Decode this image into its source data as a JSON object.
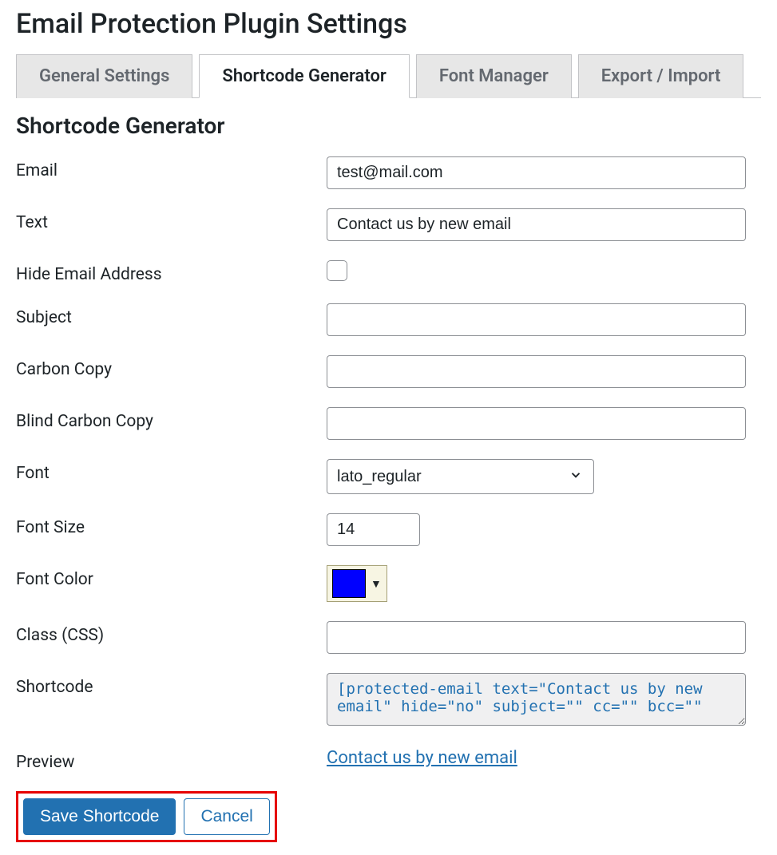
{
  "page_title": "Email Protection Plugin Settings",
  "tabs": {
    "general": "General Settings",
    "shortcode": "Shortcode Generator",
    "font": "Font Manager",
    "export": "Export / Import"
  },
  "section_title": "Shortcode Generator",
  "form": {
    "email": {
      "label": "Email",
      "value": "test@mail.com"
    },
    "text": {
      "label": "Text",
      "value": "Contact us by new email"
    },
    "hide_email": {
      "label": "Hide Email Address",
      "checked": false
    },
    "subject": {
      "label": "Subject",
      "value": ""
    },
    "cc": {
      "label": "Carbon Copy",
      "value": ""
    },
    "bcc": {
      "label": "Blind Carbon Copy",
      "value": ""
    },
    "font": {
      "label": "Font",
      "value": "lato_regular"
    },
    "font_size": {
      "label": "Font Size",
      "value": "14"
    },
    "font_color": {
      "label": "Font Color",
      "value": "#0000ff"
    },
    "css_class": {
      "label": "Class (CSS)",
      "value": ""
    },
    "shortcode": {
      "label": "Shortcode",
      "value": "[protected-email text=\"Contact us by new email\" hide=\"no\" subject=\"\" cc=\"\" bcc=\"\""
    },
    "preview": {
      "label": "Preview",
      "link_text": "Contact us by new email"
    }
  },
  "buttons": {
    "save": "Save Shortcode",
    "cancel": "Cancel"
  }
}
